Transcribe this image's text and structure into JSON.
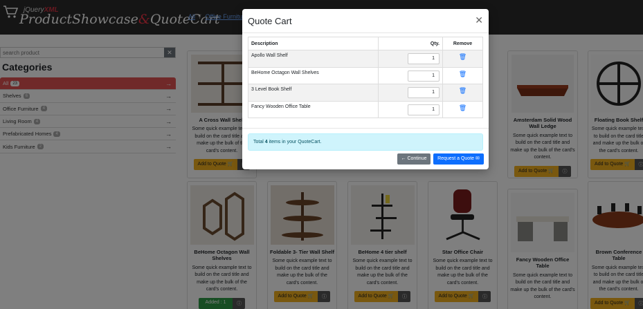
{
  "header": {
    "brand_small_prefix": "jQuery",
    "brand_small_accent": "XML",
    "brand_part1": "ProductShowcase",
    "brand_amp": "&",
    "brand_part2": "QuoteCart",
    "breadcrumb": [
      "All",
      "Office Furniture"
    ]
  },
  "sidebar": {
    "search_placeholder": "search product",
    "categories_title": "Categories",
    "categories": [
      {
        "label": "All",
        "count": "23"
      },
      {
        "label": "Shelves",
        "count": "6"
      },
      {
        "label": "Office Furniture",
        "count": "4"
      },
      {
        "label": "Living Room",
        "count": "4"
      },
      {
        "label": "Prefabricated Homes",
        "count": "4"
      },
      {
        "label": "Kids Furniture",
        "count": "2"
      }
    ]
  },
  "cards": {
    "text": "Some quick example text to build on the card title and make up the bulk of the card's content.",
    "add_label": "Add to Quote",
    "added_label": "Added : 1",
    "info_icon": "info-icon",
    "row1": [
      {
        "title": "A Cross Wall Shelf"
      },
      {
        "title": "Amsterdam Solid Wood Wall Ledge"
      },
      {
        "title": "Floating Book Shelf"
      }
    ],
    "row2": [
      {
        "title": "BeHome Octagon Wall Shelves"
      },
      {
        "title": "Foldable 3- Tier Wall Shelf"
      },
      {
        "title": "BeHome 4 tier shelf"
      },
      {
        "title": "Star Office Chair"
      },
      {
        "title": "Fancy Wooden Office Table"
      },
      {
        "title": "Brown Conference Table"
      }
    ]
  },
  "modal": {
    "title": "Quote Cart",
    "close_icon": "close-icon",
    "columns": {
      "description": "Description",
      "qty": "Qty.",
      "remove": "Remove"
    },
    "items": [
      {
        "description": "Apollo Wall Shelf",
        "qty": "1"
      },
      {
        "description": "BeHome Octagon Wall Shelves",
        "qty": "1"
      },
      {
        "description": "3 Level Book Shelf",
        "qty": "1"
      },
      {
        "description": "Fancy Wooden Office Table",
        "qty": "1"
      }
    ],
    "total_prefix": "Total ",
    "total_count": "4",
    "total_suffix": " items in your QuoteCart.",
    "continue_label": "Continue",
    "request_label": "Request a Quote"
  },
  "colors": {
    "accent": "#e05252",
    "primary": "#0d6efd",
    "warning": "#f2b01e",
    "success": "#2f9b47"
  }
}
